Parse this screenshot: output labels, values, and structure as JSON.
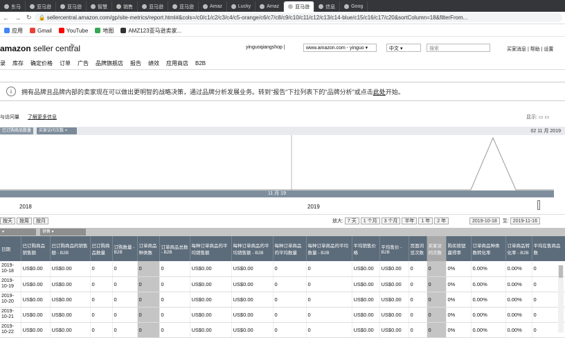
{
  "browser": {
    "tabs": [
      "东马",
      "亚马逊",
      "亚马逊",
      "智慧",
      "销售",
      "亚马逊",
      "亚马逊",
      "Amaz",
      "Lucky",
      "Amaz",
      "亚马逊",
      "信息",
      "Goog"
    ],
    "url": "sellercentral.amazon.com/gp/site-metrics/report.html#&cols=/c0/c1/c2/c3/c4/c5-orange/c6/c7/c8/c9/c10/c11/c12/c13/c14-blue/c15/c16/c17/c20&sortColumn=18&filterFrom..."
  },
  "bookmarks": [
    "应用",
    "Gmail",
    "YouTube",
    "地图",
    "AMZ123亚马逊卖家..."
  ],
  "header": {
    "logo_bold": "amazon",
    "logo_rest": " seller central",
    "store": "yinguoqiangshop",
    "store_sep": "|",
    "marketplace": "www.amazon.com - yinguo",
    "language": "中文",
    "search_placeholder": "搜索",
    "links": "买家消息 | 帮助 | 设置"
  },
  "nav": [
    "录",
    "库存",
    "确定价格",
    "订单",
    "广告",
    "品牌旗舰店",
    "报告",
    "绩效",
    "应用商店",
    "B2B"
  ],
  "info": {
    "text": "拥有品牌且品牌内部的卖家现在可以做出更明智的战略决策，通过品牌分析发展业务。转到\"报告\"下拉列表下的\"品牌分析\"或点击",
    "link": "此处",
    "suffix": "开始。"
  },
  "links": {
    "sessions": "与访问量",
    "learn": "了解更多信息"
  },
  "display": "显示:",
  "chips": {
    "left": "已订购商品数量",
    "right": "买家访问次数",
    "close": "×"
  },
  "chart": {
    "date_label": "02 11 月 2019",
    "axis_label": "11 月 19",
    "years": [
      "2018",
      "2019"
    ]
  },
  "controls": {
    "left": [
      "按天",
      "按周",
      "按月"
    ],
    "zoom": "放大:",
    "ranges": [
      "7 天",
      "1 个月",
      "3 个月",
      "半年",
      "1 年",
      "2 年"
    ],
    "from": "2019-10-18",
    "to_label": "至:",
    "to": "2019-11-16"
  },
  "selects": {
    "a": "",
    "b": "销售"
  },
  "table": {
    "headers": [
      "日期",
      "已订购商品销售额",
      "已订购商品的销售额 - B2B",
      "已订购商品数量",
      "订购数量 - B2B",
      "订单商品种类数",
      "订单商品总数 - B2B",
      "每种订单商品的平均销售额",
      "每种订单商品的平均销售额 - B2B",
      "每种订单商品的平均数量",
      "每种订单商品的平均数量 - B2B",
      "平均销售价格",
      "平均售价 - B2B",
      "页面浏览次数",
      "买家访问次数",
      "购买按钮赢得率",
      "订单商品种类数转化率",
      "订单商品转化率 - B2B",
      "平均在售商品数"
    ],
    "rows": [
      [
        "2019-10-18",
        "US$0.00",
        "US$0.00",
        "0",
        "0",
        "0",
        "0",
        "US$0.00",
        "US$0.00",
        "0",
        "0",
        "US$0.00",
        "US$0.00",
        "0",
        "0",
        "0%",
        "0.00%",
        "0.00%",
        "0"
      ],
      [
        "2019-10-19",
        "US$0.00",
        "US$0.00",
        "0",
        "0",
        "0",
        "0",
        "US$0.00",
        "US$0.00",
        "0",
        "0",
        "US$0.00",
        "US$0.00",
        "0",
        "0",
        "0%",
        "0.00%",
        "0.00%",
        "0"
      ],
      [
        "2019-10-20",
        "US$0.00",
        "US$0.00",
        "0",
        "0",
        "0",
        "0",
        "US$0.00",
        "US$0.00",
        "0",
        "0",
        "US$0.00",
        "US$0.00",
        "0",
        "0",
        "0%",
        "0.00%",
        "0.00%",
        "0"
      ],
      [
        "2019-10-21",
        "US$0.00",
        "US$0.00",
        "0",
        "0",
        "0",
        "0",
        "US$0.00",
        "US$0.00",
        "0",
        "0",
        "US$0.00",
        "US$0.00",
        "0",
        "0",
        "0%",
        "0.00%",
        "0.00%",
        "0"
      ],
      [
        "2019-10-22",
        "US$0.00",
        "US$0.00",
        "0",
        "0",
        "0",
        "0",
        "US$0.00",
        "US$0.00",
        "0",
        "0",
        "US$0.00",
        "US$0.00",
        "0",
        "0",
        "0%",
        "0.00%",
        "0.00%",
        "0"
      ]
    ]
  }
}
